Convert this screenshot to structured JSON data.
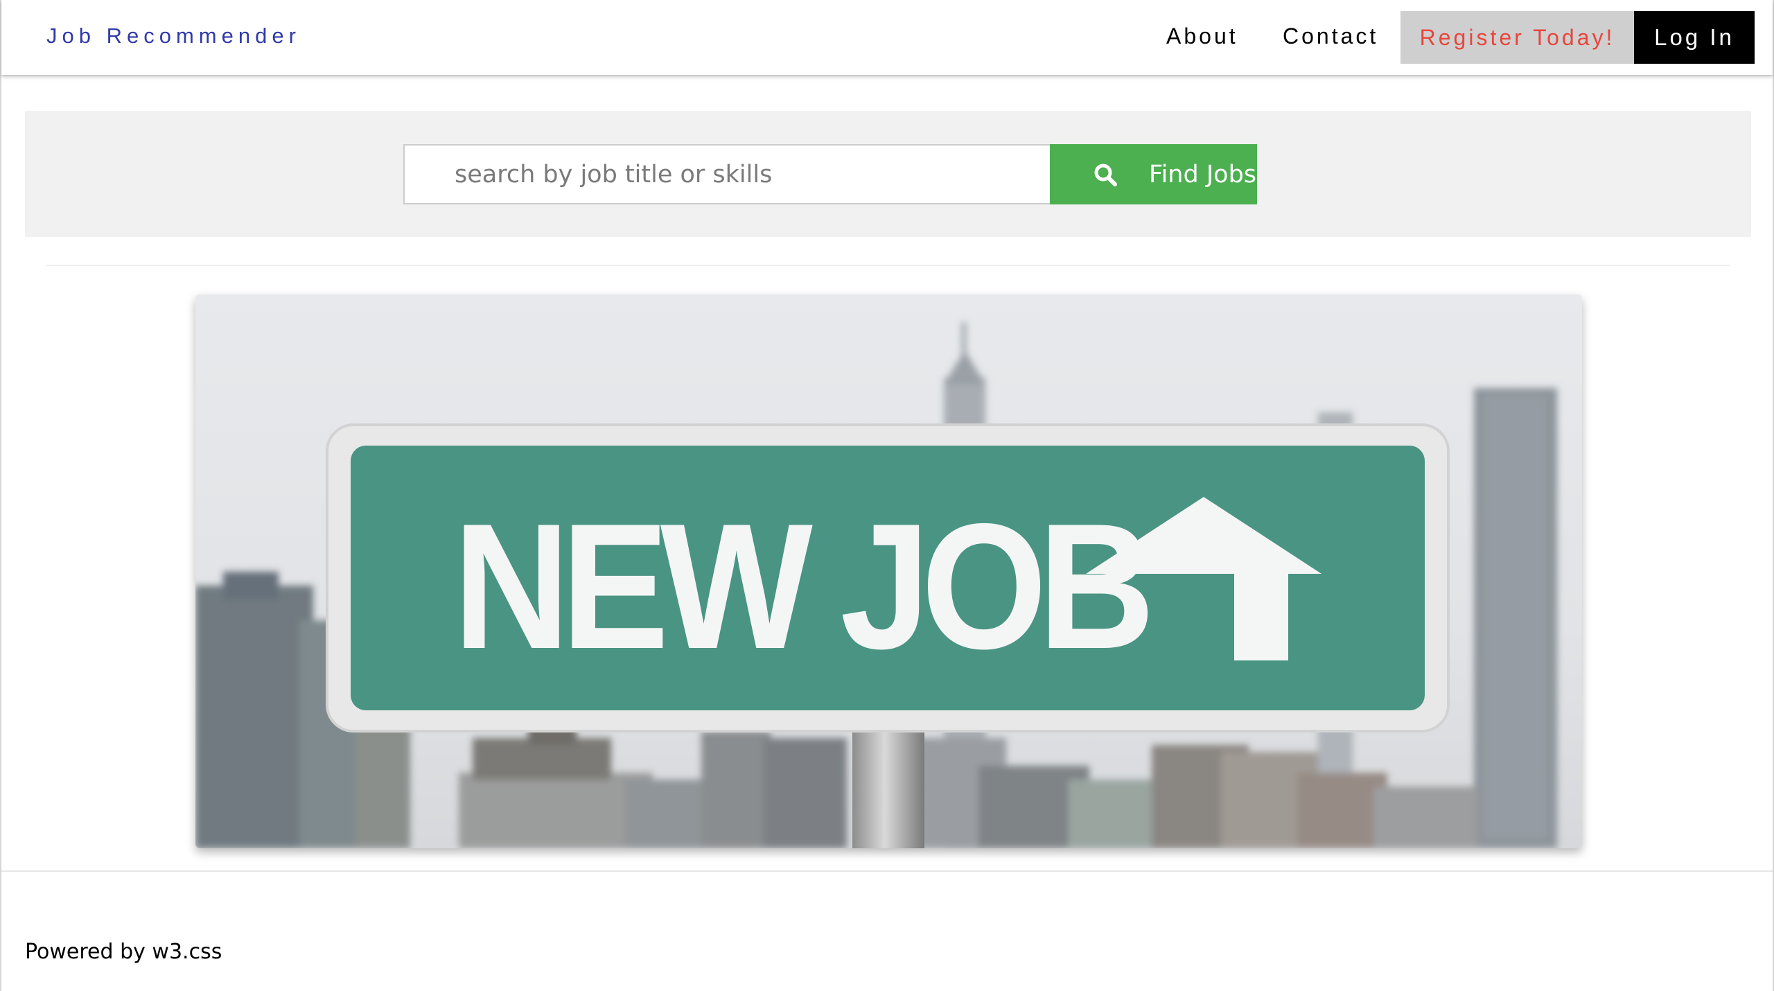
{
  "nav": {
    "brand": "Job Recommender",
    "about": "About",
    "contact": "Contact",
    "register": "Register Today!",
    "login": "Log In"
  },
  "search": {
    "placeholder": "search by job title or skills",
    "value": "",
    "button_label": "Find Jobs",
    "button_icon": "search-icon"
  },
  "hero": {
    "sign_text": "NEW JOB"
  },
  "footer": {
    "text": "Powered by w3.css"
  },
  "colors": {
    "brand": "#2f3aaa",
    "register_text": "#e8453c",
    "register_bg": "#cfcfcf",
    "login_bg": "#000000",
    "find_button": "#4caf50",
    "sign_green": "#4a9484"
  }
}
